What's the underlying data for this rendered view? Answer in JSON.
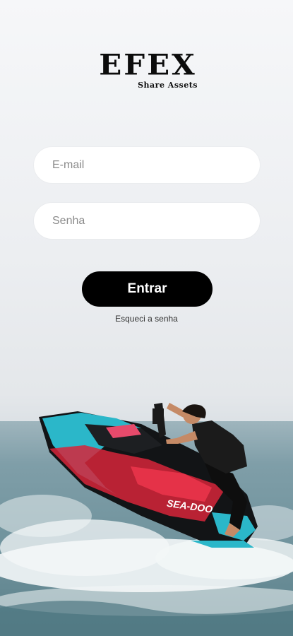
{
  "brand": {
    "name": "EFEX",
    "tagline": "Share Assets"
  },
  "login": {
    "email_placeholder": "E-mail",
    "password_placeholder": "Senha",
    "submit_label": "Entrar",
    "forgot_label": "Esqueci a senha"
  },
  "hero": {
    "image": "jet-ski-rider-on-ocean-wave",
    "watercraft_brand": "SEA-DOO"
  },
  "colors": {
    "button_bg": "#000000",
    "button_text": "#ffffff",
    "accent_cyan": "#2bb7c9",
    "accent_red": "#e0283a"
  }
}
